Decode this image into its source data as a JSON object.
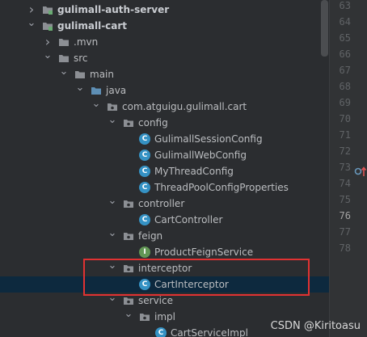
{
  "tree": [
    {
      "label": "gulimall-auth-server",
      "depth": 0,
      "expanded": false,
      "icon": "module-folder-icon",
      "bold": true
    },
    {
      "label": "gulimall-cart",
      "depth": 0,
      "expanded": true,
      "icon": "module-folder-icon",
      "bold": true
    },
    {
      "label": ".mvn",
      "depth": 1,
      "expanded": false,
      "icon": "folder-icon"
    },
    {
      "label": "src",
      "depth": 1,
      "expanded": true,
      "icon": "folder-icon"
    },
    {
      "label": "main",
      "depth": 2,
      "expanded": true,
      "icon": "folder-icon"
    },
    {
      "label": "java",
      "depth": 3,
      "expanded": true,
      "icon": "source-folder-icon"
    },
    {
      "label": "com.atguigu.gulimall.cart",
      "depth": 4,
      "expanded": true,
      "icon": "package-icon"
    },
    {
      "label": "config",
      "depth": 5,
      "expanded": true,
      "icon": "package-icon"
    },
    {
      "label": "GulimallSessionConfig",
      "depth": 6,
      "icon": "class-icon"
    },
    {
      "label": "GulimallWebConfig",
      "depth": 6,
      "icon": "class-icon"
    },
    {
      "label": "MyThreadConfig",
      "depth": 6,
      "icon": "class-icon"
    },
    {
      "label": "ThreadPoolConfigProperties",
      "depth": 6,
      "icon": "class-icon"
    },
    {
      "label": "controller",
      "depth": 5,
      "expanded": true,
      "icon": "package-icon"
    },
    {
      "label": "CartController",
      "depth": 6,
      "icon": "class-icon"
    },
    {
      "label": "feign",
      "depth": 5,
      "expanded": true,
      "icon": "package-icon"
    },
    {
      "label": "ProductFeignService",
      "depth": 6,
      "icon": "interface-icon"
    },
    {
      "label": "interceptor",
      "depth": 5,
      "expanded": true,
      "icon": "package-icon"
    },
    {
      "label": "CartInterceptor",
      "depth": 6,
      "icon": "class-icon",
      "selected": true
    },
    {
      "label": "service",
      "depth": 5,
      "expanded": true,
      "icon": "package-icon"
    },
    {
      "label": "impl",
      "depth": 6,
      "expanded": true,
      "icon": "package-icon"
    },
    {
      "label": "CartServiceImpl",
      "depth": 7,
      "icon": "class-icon"
    }
  ],
  "gutter": {
    "line_numbers": [
      "63",
      "64",
      "65",
      "66",
      "67",
      "68",
      "69",
      "70",
      "71",
      "72",
      "73",
      "74",
      "75",
      "76",
      "77",
      "78"
    ],
    "current_line": "76",
    "marker_line": "71",
    "marker_icon": "override-method-icon"
  },
  "watermark": "CSDN @Kiritoasu",
  "colors": {
    "selection": "#0d293e",
    "highlight_box": "#e03232",
    "class_icon": "#3592c4",
    "interface_icon": "#629755",
    "folder": "#8c8f94",
    "package": "#8c8f94"
  }
}
